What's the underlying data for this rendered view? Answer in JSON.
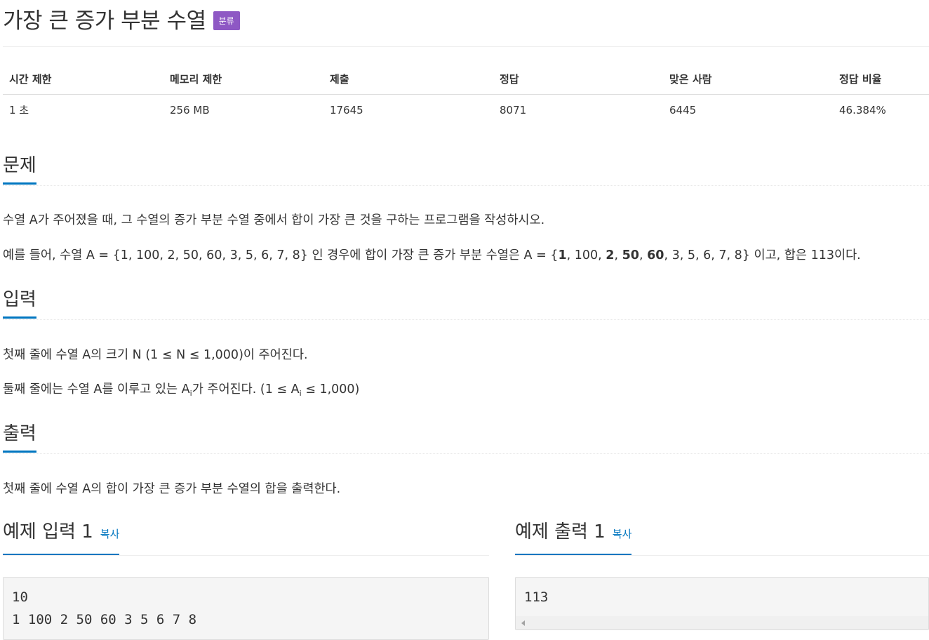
{
  "problem": {
    "title": "가장 큰 증가 부분 수열",
    "badge": "분류"
  },
  "info_table": {
    "headers": [
      "시간 제한",
      "메모리 제한",
      "제출",
      "정답",
      "맞은 사람",
      "정답 비율"
    ],
    "values": [
      "1 초",
      "256 MB",
      "17645",
      "8071",
      "6445",
      "46.384%"
    ]
  },
  "sections": {
    "problem": {
      "heading": "문제",
      "p1": "수열 A가 주어졌을 때, 그 수열의 증가 부분 수열 중에서 합이 가장 큰 것을 구하는 프로그램을 작성하시오.",
      "p2_prefix": "예를 들어, 수열 A = {1, 100, 2, 50, 60, 3, 5, 6, 7, 8} 인 경우에 합이 가장 큰 증가 부분 수열은 A = {",
      "p2_b1": "1",
      "p2_s1": ", 100, ",
      "p2_b2": "2",
      "p2_s2": ", ",
      "p2_b3": "50",
      "p2_s3": ", ",
      "p2_b4": "60",
      "p2_suffix": ", 3, 5, 6, 7, 8} 이고, 합은 113이다."
    },
    "input": {
      "heading": "입력",
      "p1": "첫째 줄에 수열 A의 크기 N (1 ≤ N ≤ 1,000)이 주어진다.",
      "p2_a": "둘째 줄에는 수열 A를 이루고 있는 A",
      "p2_sub1": "i",
      "p2_b": "가 주어진다. (1 ≤ A",
      "p2_sub2": "i",
      "p2_c": " ≤ 1,000)"
    },
    "output": {
      "heading": "출력",
      "p1": "첫째 줄에 수열 A의 합이 가장 큰 증가 부분 수열의 합을 출력한다."
    }
  },
  "examples": {
    "input": {
      "heading": "예제 입력 1",
      "copy_label": "복사",
      "lines": [
        "10",
        "1 100 2 50 60 3 5 6 7 8"
      ]
    },
    "output": {
      "heading": "예제 출력 1",
      "copy_label": "복사",
      "lines": [
        "113"
      ]
    }
  }
}
